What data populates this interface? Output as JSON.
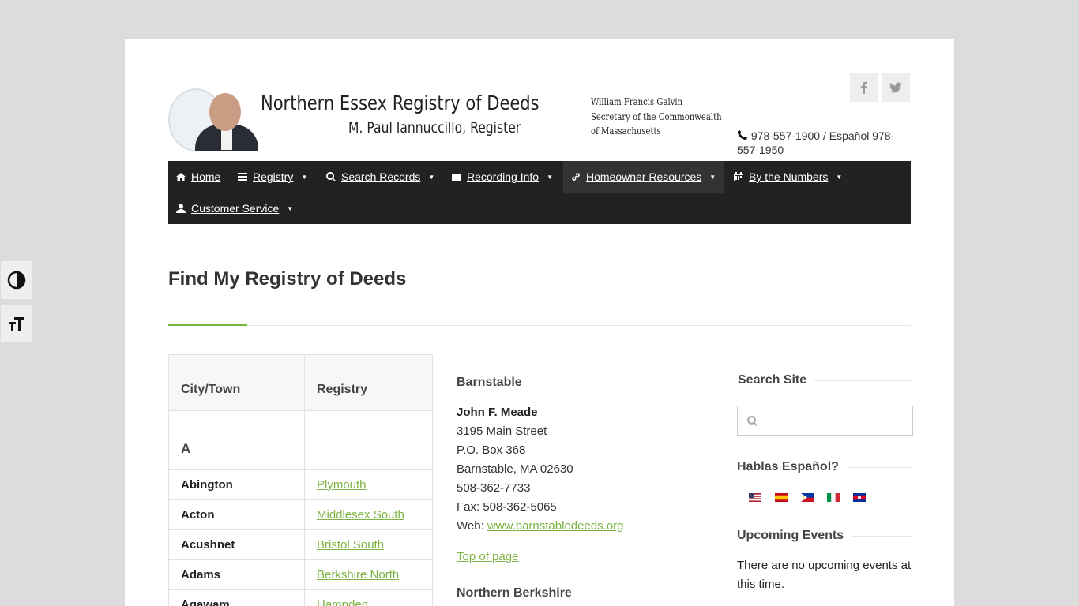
{
  "header": {
    "logo_title": "Northern Essex Registry of Deeds",
    "logo_subtitle": "M. Paul Iannuccillo, Register",
    "galvin_lines": [
      "William Francis Galvin",
      "Secretary of the Commonwealth",
      "of Massachusetts"
    ],
    "phone": "978-557-1900 / Español 978-557-1950",
    "social": [
      "facebook-icon",
      "twitter-icon"
    ]
  },
  "nav": {
    "items": [
      {
        "label": "Home",
        "icon": "home-icon"
      },
      {
        "label": "Registry",
        "icon": "list-icon"
      },
      {
        "label": "Search Records",
        "icon": "search-icon"
      },
      {
        "label": "Recording Info",
        "icon": "folder-icon"
      },
      {
        "label": "Homeowner Resources",
        "icon": "link-icon"
      },
      {
        "label": "By the Numbers",
        "icon": "calendar-icon"
      },
      {
        "label": "Customer Service",
        "icon": "user-icon"
      }
    ],
    "active": "Homeowner Resources"
  },
  "page": {
    "title": "Find My Registry of Deeds"
  },
  "table": {
    "headers": [
      "City/Town",
      "Registry"
    ],
    "group_letter": "A",
    "rows": [
      {
        "town": "Abington",
        "registry": "Plymouth"
      },
      {
        "town": "Acton",
        "registry": "Middlesex South"
      },
      {
        "town": "Acushnet",
        "registry": "Bristol South"
      },
      {
        "town": "Adams",
        "registry": "Berkshire North"
      },
      {
        "town": "Agawam",
        "registry": "Hampden"
      }
    ]
  },
  "middle": {
    "heading": "Barnstable",
    "name": "John F. Meade",
    "address1": "3195 Main Street",
    "address2": "P.O. Box 368",
    "address3": "Barnstable, MA 02630",
    "phone": "508-362-7733",
    "fax": "Fax: 508-362-5065",
    "web_label": "Web: ",
    "web_link": "www.barnstabledeeds.org",
    "top_link": "Top of page",
    "heading2": "Northern Berkshire"
  },
  "sidebar": {
    "search_title": "Search Site",
    "search_placeholder": "",
    "spanish_title": "Hablas Español?",
    "flags": [
      "us-flag",
      "spain-flag",
      "philippines-flag",
      "italy-flag",
      "cambodia-flag"
    ],
    "events_title": "Upcoming Events",
    "events_text": "There are no upcoming events at this time."
  },
  "accessibility": [
    "contrast-icon",
    "text-size-icon"
  ]
}
